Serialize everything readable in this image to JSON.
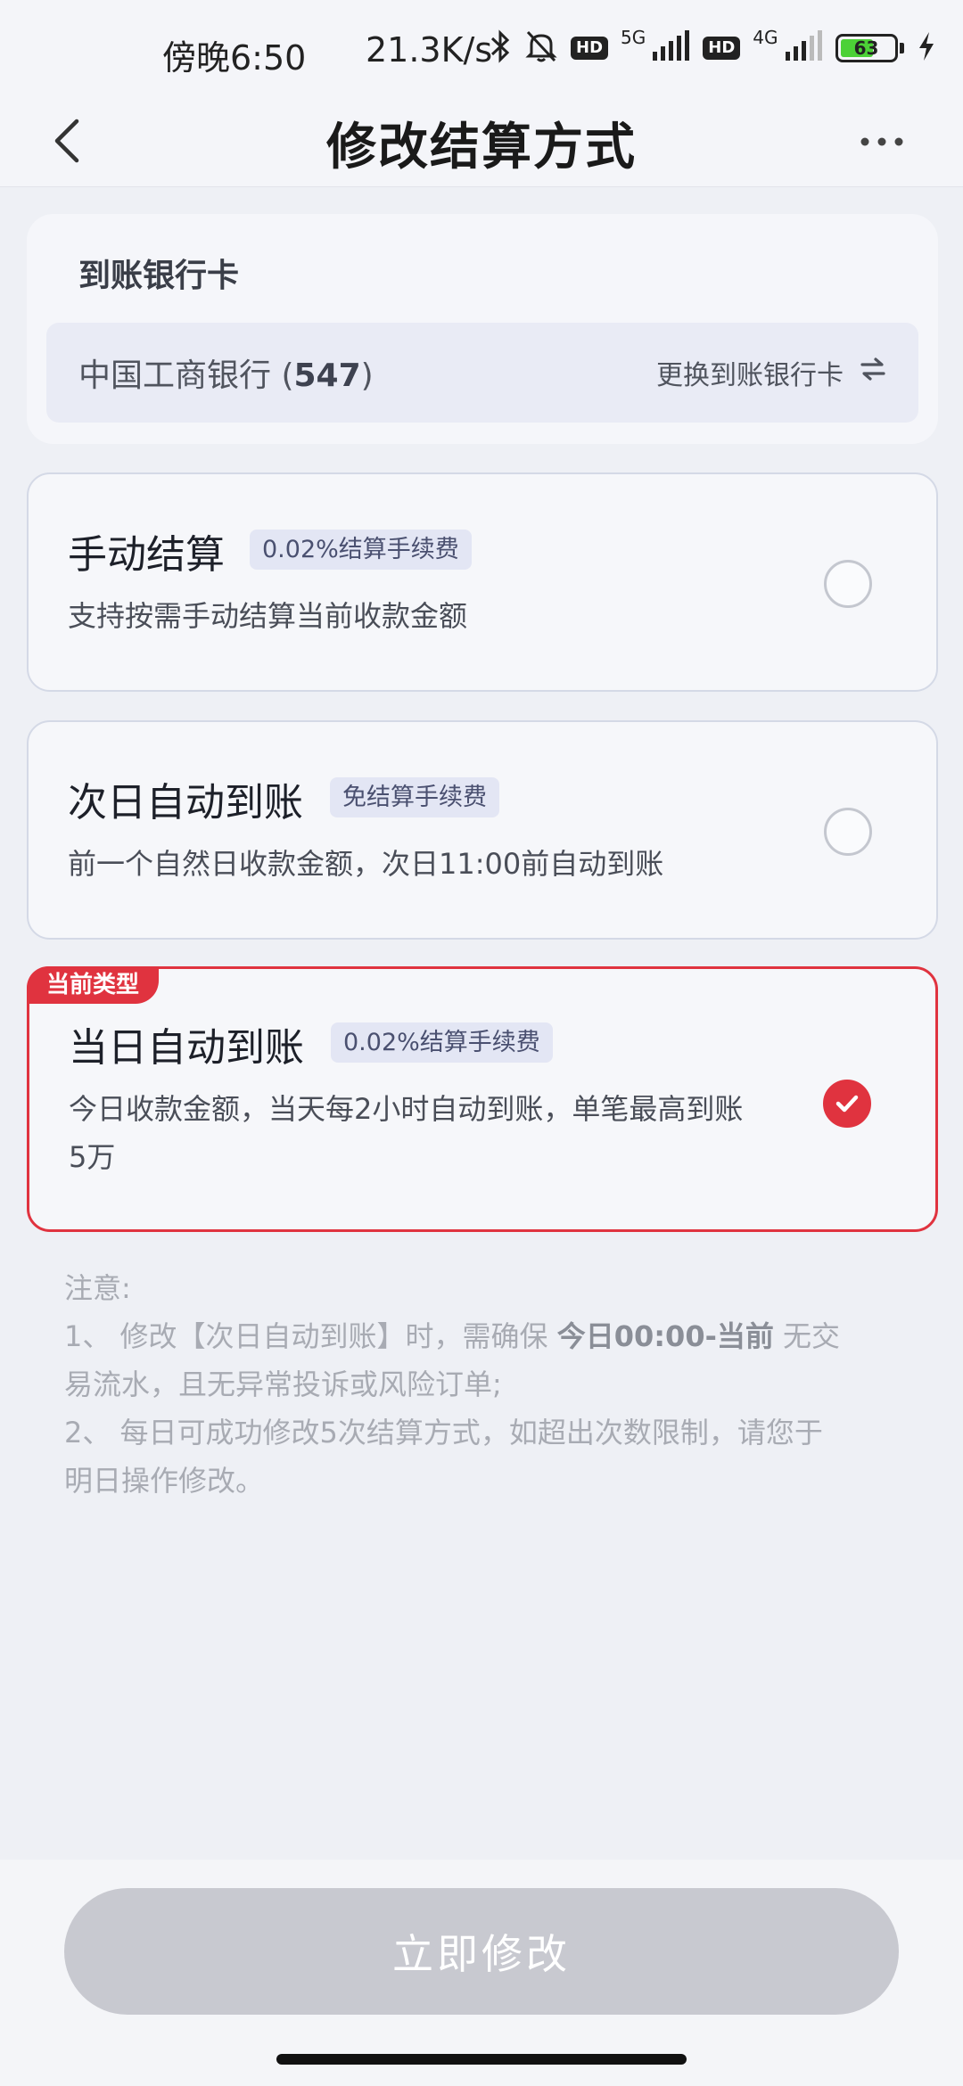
{
  "status_bar": {
    "time": "傍晚6:50",
    "net_speed": "21.3K/s",
    "hd1": "HD",
    "net1": "5G",
    "hd2": "HD",
    "net2": "4G",
    "battery": "63",
    "battery_level": 0.63
  },
  "nav": {
    "title": "修改结算方式"
  },
  "bank": {
    "section_title": "到账银行卡",
    "bank_name": "中国工商银行 (",
    "card_suffix": "547",
    "bank_name_end": ")",
    "change_label": "更换到账银行卡"
  },
  "options": [
    {
      "title": "手动结算",
      "tag": "0.02%结算手续费",
      "desc_line1": "支持按需手动结算当前收款金额",
      "desc_line2": "",
      "selected": false
    },
    {
      "title": "次日自动到账",
      "tag": "免结算手续费",
      "desc_line1": "前一个自然日收款金额，次日11:00前自动到账",
      "desc_line2": "",
      "selected": false
    },
    {
      "title": "当日自动到账",
      "tag": "0.02%结算手续费",
      "badge": "当前类型",
      "desc_line1": "今日收款金额，当天每2小时自动到账，单笔最高到账",
      "desc_line2": "5万",
      "selected": true
    }
  ],
  "notes": {
    "heading": "注意:",
    "item1_a": "1、 修改【次日自动到账】时，需确保 ",
    "item1_bold": "今日00:00-当前",
    "item1_b": " 无交",
    "item1_line2": "易流水，且无异常投诉或风险订单;",
    "item2_line1": "2、 每日可成功修改5次结算方式，如超出次数限制，请您于",
    "item2_line2": "明日操作修改。"
  },
  "submit": {
    "label": "立即修改"
  },
  "colors": {
    "accent_red": "#e0333f",
    "disabled_button": "#c8c9d0"
  },
  "icons": [
    "back-arrow-icon",
    "more-dots-icon",
    "swap-icon",
    "checkmark-icon",
    "bluetooth-icon",
    "bell-off-icon",
    "signal-icon",
    "charging-icon"
  ]
}
